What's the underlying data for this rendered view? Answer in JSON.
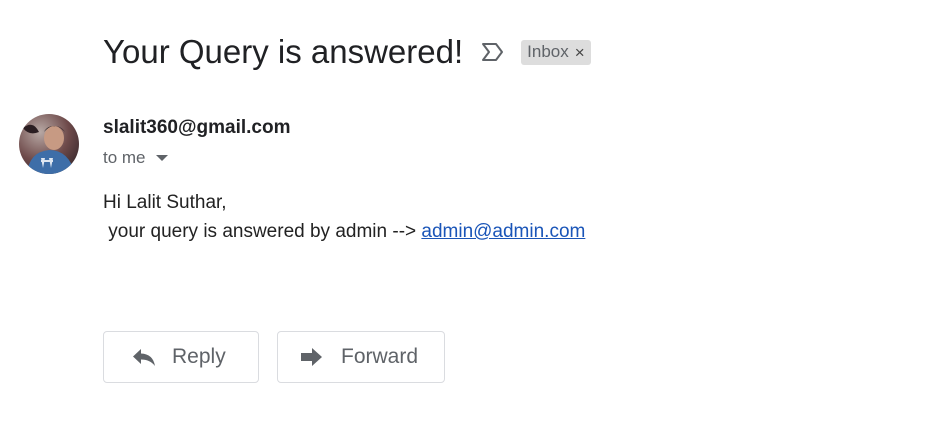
{
  "email": {
    "subject": "Your Query is answered!",
    "label": "Inbox",
    "label_close": "×",
    "sender": "slalit360@gmail.com",
    "recipient": "to me",
    "body": {
      "greeting": "Hi Lalit Suthar,",
      "message": " your query is answered by admin --> ",
      "link_text": "admin@admin.com"
    }
  },
  "actions": {
    "reply_label": "Reply",
    "forward_label": "Forward"
  },
  "icons": {
    "importance": "importance-marker-icon",
    "reply": "reply-arrow-icon",
    "forward": "forward-arrow-icon",
    "recipient_details": "caret-down-icon"
  },
  "colors": {
    "link": "#1a55b8",
    "label_chip_bg": "#dddddd",
    "muted_text": "#5f6368"
  }
}
